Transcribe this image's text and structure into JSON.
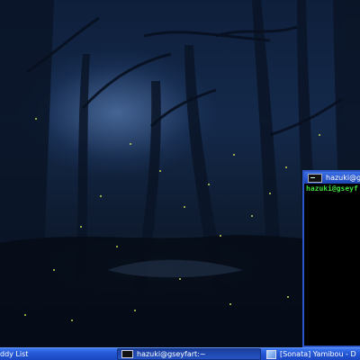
{
  "wallpaper": {
    "name": "dark-forest-fireflies-wallpaper"
  },
  "terminal": {
    "title": "hazuki@gs",
    "prompt": "hazuki@gseyf"
  },
  "taskbar": {
    "items": [
      {
        "label": "ddy List",
        "icon": "buddy-list-icon",
        "active": false
      },
      {
        "label": "hazuki@gseyfart:~",
        "icon": "terminal-icon",
        "active": true
      },
      {
        "label": "[Sonata] Yamibou - D",
        "icon": "music-player-icon",
        "active": false
      }
    ]
  }
}
